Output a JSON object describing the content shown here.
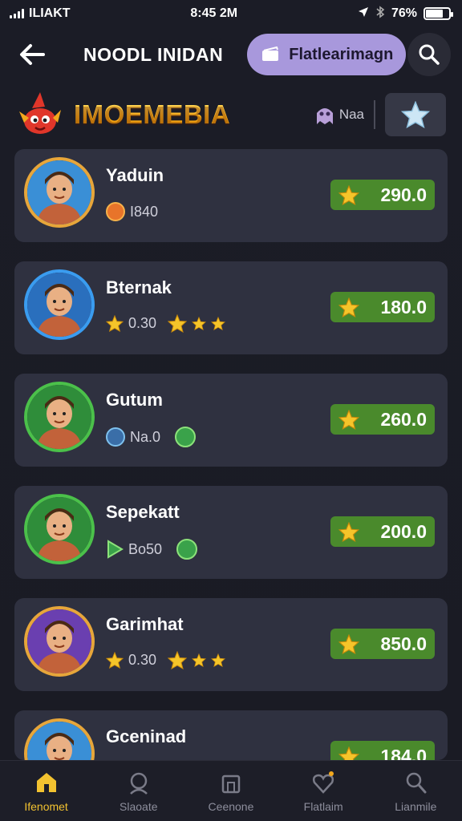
{
  "status_bar": {
    "carrier": "ILIAKT",
    "time": "8:45 2M",
    "battery_pct": "76%",
    "battery_level": 0.76
  },
  "header": {
    "title": "NOODL INIDAN",
    "pill_label": "Flatlearimagn",
    "back_icon": "arrow-left-icon",
    "search_icon": "search-icon"
  },
  "brand": {
    "name": "IMOEMEBIA",
    "badge_text": "Naa",
    "star_button_icon": "star-icon"
  },
  "players": [
    {
      "name": "Yaduin",
      "sub_text": "I840",
      "sub_icon": "orange-coin",
      "score": "290.0",
      "ring": "#e7a63a",
      "bg": "#3a8fd6",
      "extra_stars": 0
    },
    {
      "name": "Bternak",
      "sub_text": "0.30",
      "sub_icon": "star",
      "score": "180.0",
      "ring": "#3a9cf0",
      "bg": "#2a6fbd",
      "extra_stars": 3
    },
    {
      "name": "Gutum",
      "sub_text": "Na.0",
      "sub_icon": "blue-coin",
      "score": "260.0",
      "ring": "#4bc14a",
      "bg": "#2f8d3a",
      "extra_stars": 0
    },
    {
      "name": "Sepekatt",
      "sub_text": "Bo50",
      "sub_icon": "play",
      "score": "200.0",
      "ring": "#4bc14a",
      "bg": "#2f8d3a",
      "extra_stars": 0
    },
    {
      "name": "Garimhat",
      "sub_text": "0.30",
      "sub_icon": "star",
      "score": "850.0",
      "ring": "#e7a63a",
      "bg": "#6a3fb0",
      "extra_stars": 3
    },
    {
      "name": "Gceninad",
      "sub_text": "",
      "sub_icon": "gold-bar",
      "score": "184.0",
      "ring": "#e7a63a",
      "bg": "#3a8fd6",
      "extra_stars": 0
    }
  ],
  "bottom_nav": [
    {
      "label": "Ifenomet",
      "icon": "home-icon",
      "active": true
    },
    {
      "label": "Slaoate",
      "icon": "character-icon",
      "active": false
    },
    {
      "label": "Ceenone",
      "icon": "shop-icon",
      "active": false
    },
    {
      "label": "Flatlaim",
      "icon": "heart-icon",
      "active": false
    },
    {
      "label": "Lianmile",
      "icon": "search-person-icon",
      "active": false
    }
  ],
  "colors": {
    "accent_purple": "#a898dc",
    "score_green": "#4a8a2c",
    "brand_gold": "#ffb21c",
    "active_nav": "#f2c230"
  }
}
